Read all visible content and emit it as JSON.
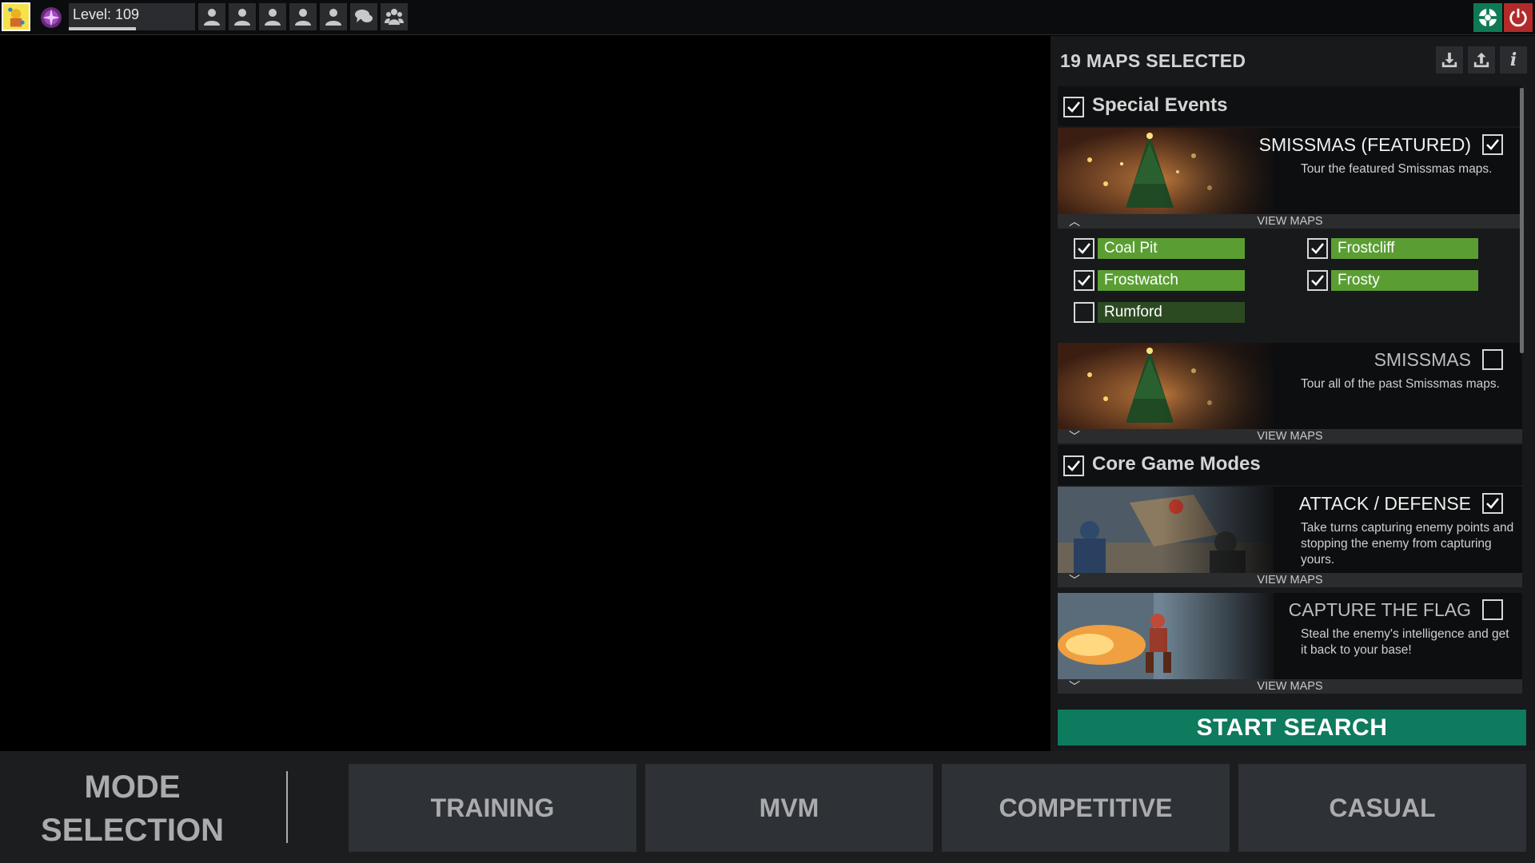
{
  "topbar": {
    "level_label": "Level: 109",
    "icons": [
      "friend-icon",
      "friend-icon",
      "friend-icon",
      "friend-icon",
      "friend-icon",
      "chat-icon",
      "party-icon"
    ]
  },
  "panel": {
    "title": "19 MAPS SELECTED",
    "info_glyph": "i",
    "groups": [
      {
        "label": "Special Events",
        "checked": true
      },
      {
        "label": "Core Game Modes",
        "checked": true
      }
    ],
    "cards": [
      {
        "title": "SMISSMAS (FEATURED)",
        "description": "Tour the featured Smissmas maps.",
        "checked": true,
        "expanded": true,
        "view_label": "VIEW MAPS",
        "chevron": "︿"
      },
      {
        "title": "SMISSMAS",
        "description": "Tour all of the past Smissmas maps.",
        "checked": false,
        "expanded": false,
        "view_label": "VIEW MAPS",
        "chevron": "﹀"
      },
      {
        "title": "ATTACK / DEFENSE",
        "description": "Take turns capturing enemy points and stopping the enemy from capturing yours.",
        "checked": true,
        "expanded": false,
        "view_label": "VIEW MAPS",
        "chevron": "﹀"
      },
      {
        "title": "CAPTURE THE FLAG",
        "description": "Steal the enemy's intelligence and get it back to your base!",
        "checked": false,
        "expanded": false,
        "view_label": "VIEW MAPS",
        "chevron": "﹀"
      }
    ],
    "maps": [
      {
        "name": "Coal Pit",
        "checked": true
      },
      {
        "name": "Frostcliff",
        "checked": true
      },
      {
        "name": "Frostwatch",
        "checked": true
      },
      {
        "name": "Frosty",
        "checked": true
      },
      {
        "name": "Rumford",
        "checked": false
      }
    ],
    "start_label": "START SEARCH"
  },
  "bottom": {
    "mode_selection_line1": "MODE",
    "mode_selection_line2": "SELECTION",
    "tabs": [
      "TRAINING",
      "MVM",
      "COMPETITIVE",
      "CASUAL"
    ]
  },
  "colors": {
    "accent_green": "#0e7a5e",
    "map_checked": "#5a9e33",
    "map_unchecked": "#2c4a22",
    "power_red": "#b32a2a"
  }
}
